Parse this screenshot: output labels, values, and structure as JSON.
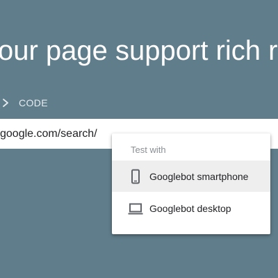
{
  "page": {
    "headline": "our page support rich r"
  },
  "code_tab": {
    "icon": "chevron-right-icon",
    "label": "CODE"
  },
  "url_input": {
    "value": "google.com/search/"
  },
  "test_menu": {
    "header": "Test with",
    "items": [
      {
        "label": "Googlebot smartphone",
        "icon": "smartphone-icon",
        "selected": true
      },
      {
        "label": "Googlebot desktop",
        "icon": "laptop-icon",
        "selected": false
      }
    ]
  },
  "colors": {
    "background": "#607d8b",
    "surface": "#ffffff",
    "selected_item": "#eeeeee",
    "muted_text": "#8a8f94"
  }
}
